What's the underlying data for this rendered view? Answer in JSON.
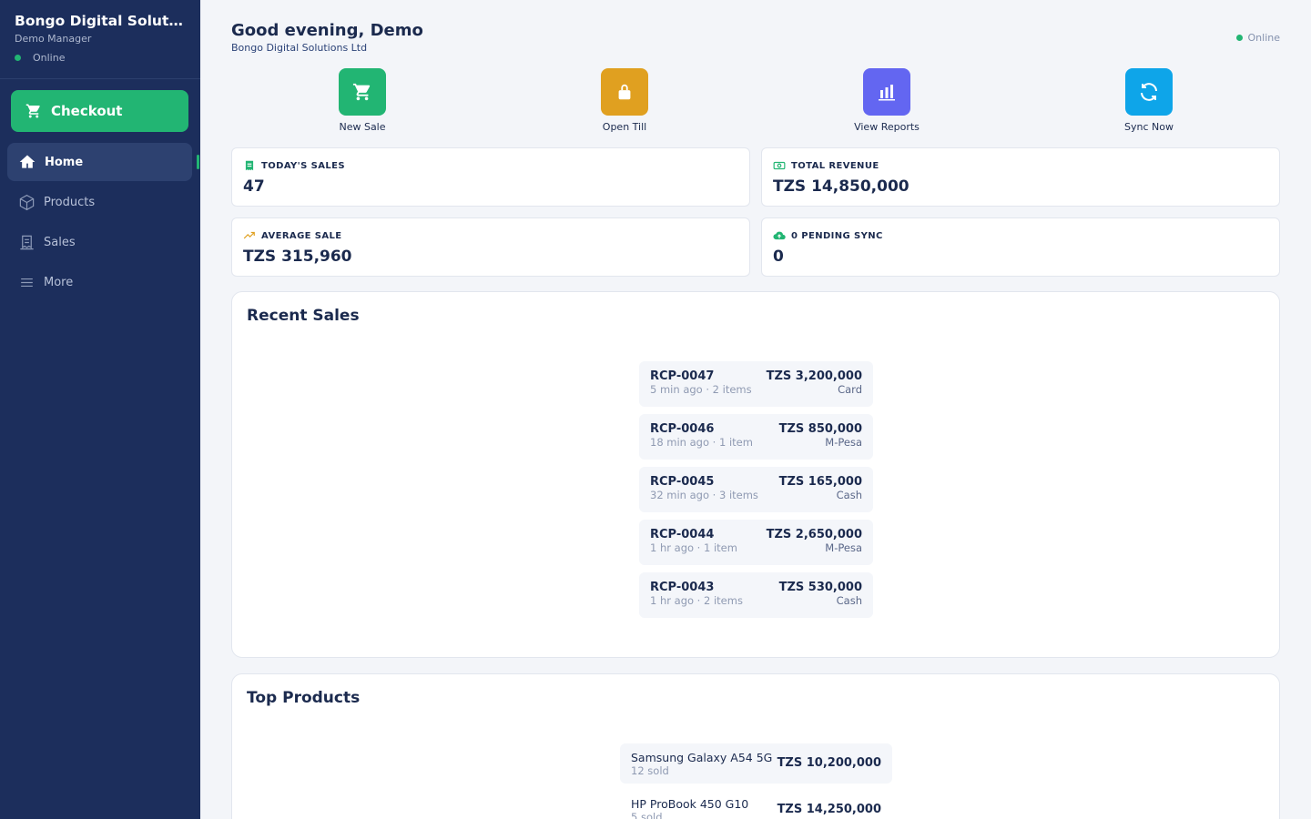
{
  "sidebar": {
    "brand_name": "Bongo Digital Soluti...",
    "role": "Demo Manager",
    "status": "Online",
    "checkout_label": "Checkout",
    "items": [
      {
        "label": "Home",
        "icon": "home-icon"
      },
      {
        "label": "Products",
        "icon": "box-icon"
      },
      {
        "label": "Sales",
        "icon": "receipt-icon"
      },
      {
        "label": "More",
        "icon": "menu-icon"
      }
    ]
  },
  "header": {
    "greeting": "Good evening, Demo",
    "company": "Bongo Digital Solutions Ltd",
    "status": "Online"
  },
  "quick_actions": [
    {
      "label": "New Sale",
      "icon": "cart-icon",
      "color": "#22b573"
    },
    {
      "label": "Open Till",
      "icon": "lock-icon",
      "color": "#e0a020"
    },
    {
      "label": "View Reports",
      "icon": "bar-chart-icon",
      "color": "#6366f1"
    },
    {
      "label": "Sync Now",
      "icon": "sync-icon",
      "color": "#0ea5e9"
    }
  ],
  "stats": [
    {
      "label": "TODAY'S SALES",
      "value": "47",
      "icon": "receipt-icon"
    },
    {
      "label": "TOTAL REVENUE",
      "value": "TZS 14,850,000",
      "icon": "money-icon"
    },
    {
      "label": "AVERAGE SALE",
      "value": "TZS 315,960",
      "icon": "trend-up-icon"
    },
    {
      "label": "0 PENDING SYNC",
      "value": "0",
      "icon": "cloud-upload-icon"
    }
  ],
  "recent_sales": {
    "title": "Recent Sales",
    "items": [
      {
        "id": "RCP-0047",
        "meta": "5 min ago · 2 items",
        "amount": "TZS 3,200,000",
        "method": "Card"
      },
      {
        "id": "RCP-0046",
        "meta": "18 min ago · 1 item",
        "amount": "TZS 850,000",
        "method": "M-Pesa"
      },
      {
        "id": "RCP-0045",
        "meta": "32 min ago · 3 items",
        "amount": "TZS 165,000",
        "method": "Cash"
      },
      {
        "id": "RCP-0044",
        "meta": "1 hr ago · 1 item",
        "amount": "TZS 2,650,000",
        "method": "M-Pesa"
      },
      {
        "id": "RCP-0043",
        "meta": "1 hr ago · 2 items",
        "amount": "TZS 530,000",
        "method": "Cash"
      }
    ]
  },
  "top_products": {
    "title": "Top Products",
    "items": [
      {
        "name": "Samsung Galaxy A54 5G",
        "sold": "12 sold",
        "amount": "TZS 10,200,000"
      },
      {
        "name": "HP ProBook 450 G10",
        "sold": "5 sold",
        "amount": "TZS 14,250,000"
      }
    ]
  }
}
